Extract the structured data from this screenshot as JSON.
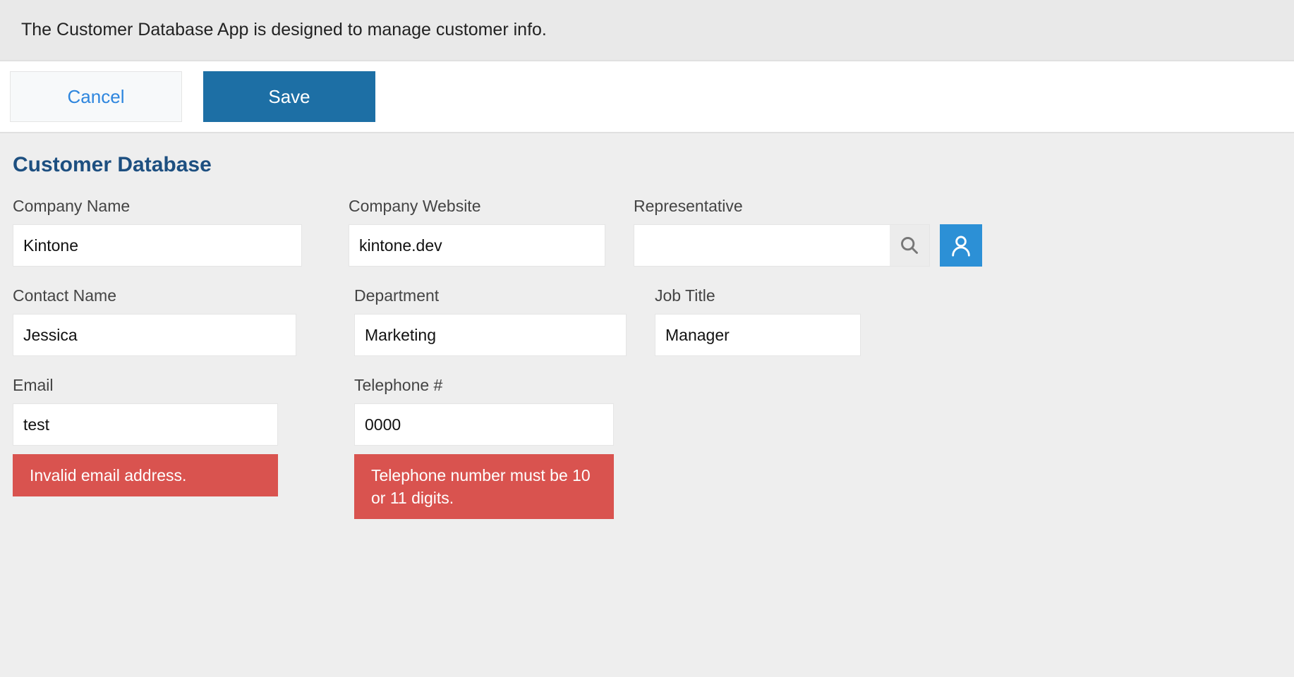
{
  "banner": {
    "description": "The Customer Database App is designed to manage customer info."
  },
  "actions": {
    "cancel": "Cancel",
    "save": "Save"
  },
  "section_title": "Customer Database",
  "fields": {
    "company_name": {
      "label": "Company Name",
      "value": "Kintone"
    },
    "company_website": {
      "label": "Company Website",
      "value": "kintone.dev"
    },
    "representative": {
      "label": "Representative",
      "value": ""
    },
    "contact_name": {
      "label": "Contact Name",
      "value": "Jessica"
    },
    "department": {
      "label": "Department",
      "value": "Marketing"
    },
    "job_title": {
      "label": "Job Title",
      "value": "Manager"
    },
    "email": {
      "label": "Email",
      "value": "test",
      "error": "Invalid email address."
    },
    "telephone": {
      "label": "Telephone #",
      "value": "0000",
      "error": "Telephone number must be 10 or 11 digits."
    }
  },
  "widths": {
    "company_name": 410,
    "company_website": 364,
    "contact_name": 402,
    "department": 386,
    "job_title": 292,
    "email": 376,
    "telephone": 368
  }
}
